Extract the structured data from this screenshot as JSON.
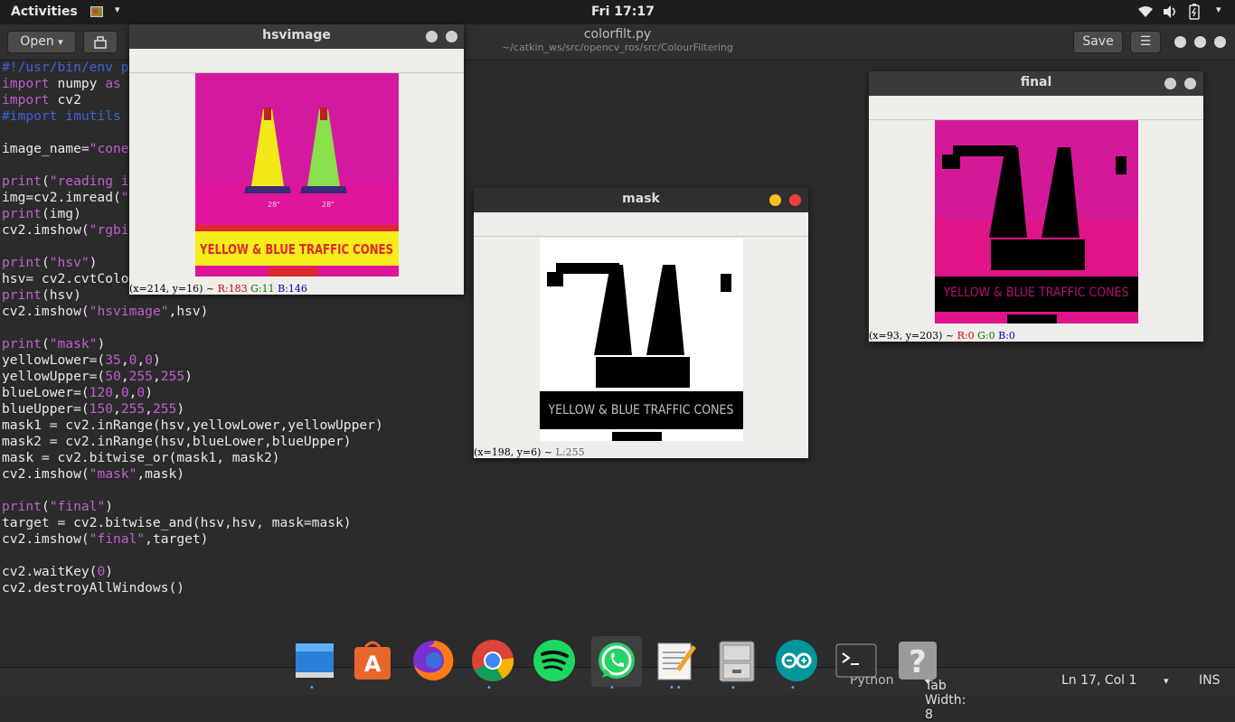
{
  "topbar": {
    "activities": "Activities",
    "clock": "Fri 17:17",
    "wifi_icon": "wifi-icon",
    "volume_icon": "volume-icon",
    "battery_icon": "battery-icon",
    "menu_chevron": "▾"
  },
  "gedit": {
    "open_label": "Open",
    "open_chevron": "▾",
    "title": "colorfilt.py",
    "subtitle": "~/catkin_ws/src/opencv_ros/src/ColourFiltering",
    "save_label": "Save",
    "menu_icon": "☰"
  },
  "code_lines": [
    "#!/usr/bin/env p",
    "import numpy as",
    "import cv2",
    "#import imutils",
    "",
    "image_name=\"cone",
    "",
    "print(\"reading i",
    "img=cv2.imread(\"",
    "print(img)",
    "cv2.imshow(\"rgbi",
    "",
    "print(\"hsv\")",
    "hsv= cv2.cvtColo",
    "print(hsv)",
    "cv2.imshow(\"hsvimage\",hsv)",
    "",
    "print(\"mask\")",
    "yellowLower=(35,0,0)",
    "yellowUpper=(50,255,255)",
    "blueLower=(120,0,0)",
    "blueUpper=(150,255,255)",
    "mask1 = cv2.inRange(hsv,yellowLower,yellowUpper)",
    "mask2 = cv2.inRange(hsv,blueLower,blueUpper)",
    "mask = cv2.bitwise_or(mask1, mask2)",
    "cv2.imshow(\"mask\",mask)",
    "",
    "print(\"final\")",
    "target = cv2.bitwise_and(hsv,hsv, mask=mask)",
    "cv2.imshow(\"final\",target)",
    "",
    "cv2.waitKey(0)",
    "cv2.destroyAllWindows()"
  ],
  "windows": {
    "hsvimage": {
      "title": "hsvimage",
      "image_caption": "YELLOW & BLUE TRAFFIC CONES",
      "status_coords": "(x=214, y=16) ~ ",
      "status_r": "R:183",
      "status_g": "G:11",
      "status_b": "B:146"
    },
    "mask": {
      "title": "mask",
      "image_caption": "YELLOW & BLUE TRAFFIC CONES",
      "status_coords": "(x=198, y=6) ~ ",
      "status_l": "L:255"
    },
    "final": {
      "title": "final",
      "image_caption": "YELLOW & BLUE TRAFFIC CONES",
      "status_coords": "(x=93, y=203) ~ ",
      "status_r": "R:0",
      "status_g": "G:0",
      "status_b": "B:0"
    }
  },
  "statusbar": {
    "language": "Python",
    "tab_width": "Tab Width: 8",
    "position": "Ln 17, Col 1",
    "mode": "INS",
    "chevron": "▾"
  },
  "dock": [
    {
      "name": "files-manager-icon"
    },
    {
      "name": "ubuntu-software-icon"
    },
    {
      "name": "firefox-icon"
    },
    {
      "name": "chrome-icon"
    },
    {
      "name": "spotify-icon"
    },
    {
      "name": "whatsapp-icon"
    },
    {
      "name": "text-editor-icon"
    },
    {
      "name": "file-cabinet-icon"
    },
    {
      "name": "arduino-icon"
    },
    {
      "name": "terminal-icon"
    },
    {
      "name": "help-icon"
    }
  ],
  "colors": {
    "hsv_bg": "#e0149a",
    "caption_yellow": "#f5ee1a",
    "caption_red": "#e0282e",
    "code_keyword": "#c05ed0",
    "code_comment": "#3c64d8"
  }
}
